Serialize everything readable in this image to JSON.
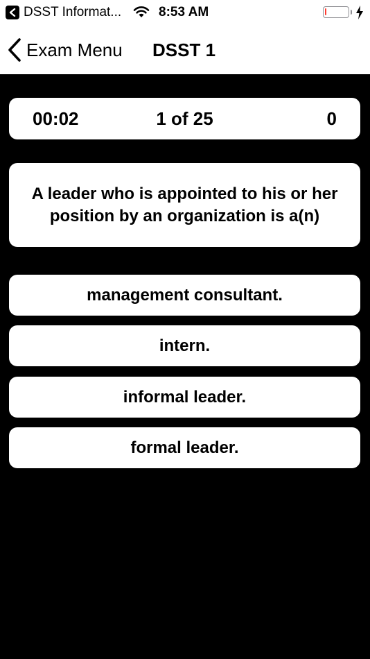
{
  "status_bar": {
    "app_name": "DSST Informat...",
    "time": "8:53 AM",
    "battery_level": 0.08,
    "battery_color": "#ff3b30",
    "icons": [
      "back-to-app-icon",
      "wifi-icon",
      "battery-icon",
      "charging-bolt-icon"
    ]
  },
  "nav": {
    "back_label": "Exam Menu",
    "title": "DSST 1"
  },
  "stats": {
    "timer": "00:02",
    "progress": "1 of 25",
    "score": "0"
  },
  "question": {
    "text": "A leader who is appointed to his or her position by an organization is a(n)"
  },
  "answers": [
    {
      "label": "management consultant."
    },
    {
      "label": "intern."
    },
    {
      "label": "informal leader."
    },
    {
      "label": "formal leader."
    }
  ],
  "colors": {
    "background": "#000000",
    "card": "#ffffff",
    "text": "#000000"
  }
}
